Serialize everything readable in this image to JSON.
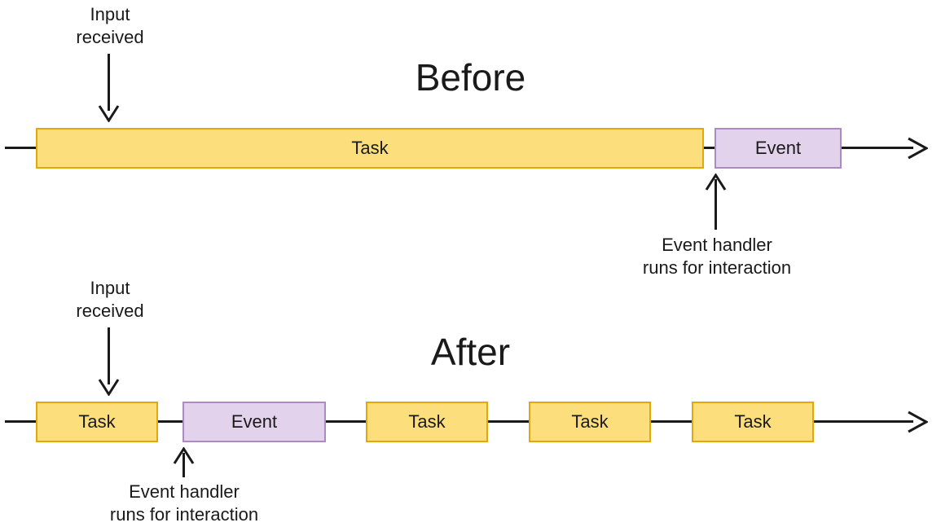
{
  "before": {
    "title": "Before",
    "input_label": "Input\nreceived",
    "handler_label": "Event handler\nruns for interaction",
    "blocks": {
      "task": "Task",
      "event": "Event"
    }
  },
  "after": {
    "title": "After",
    "input_label": "Input\nreceived",
    "handler_label": "Event handler\nruns for interaction",
    "blocks": {
      "task1": "Task",
      "event": "Event",
      "task2": "Task",
      "task3": "Task",
      "task4": "Task"
    }
  },
  "colors": {
    "task_fill": "#fcdf7c",
    "task_border": "#e2a80a",
    "event_fill": "#e3d2eb",
    "event_border": "#ad8bc0",
    "line": "#1a1a1a"
  }
}
